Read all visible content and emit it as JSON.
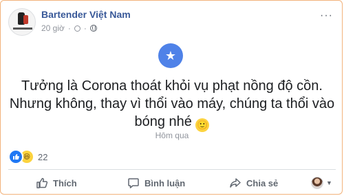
{
  "post": {
    "page_name": "Bartender Việt Nam",
    "time": "20 giờ",
    "more_label": "···",
    "badge_icon": "star-icon",
    "text_lines": [
      "Tưởng là Corona thoát khỏi vụ phạt nồng độ cồn.",
      "Nhưng không, thay vì thổi vào máy, chúng ta thổi vào",
      "bóng nhé"
    ],
    "emoji": "🙂",
    "date_label": "Hôm qua"
  },
  "reactions": {
    "types": [
      "like-icon",
      "haha-icon"
    ],
    "count": "22"
  },
  "actions": {
    "like": "Thích",
    "comment": "Bình luận",
    "share": "Chia sẻ"
  },
  "colors": {
    "accent": "#385898",
    "badge": "#4f82e8",
    "like": "#2078f4",
    "frame": "#f2b27a"
  }
}
